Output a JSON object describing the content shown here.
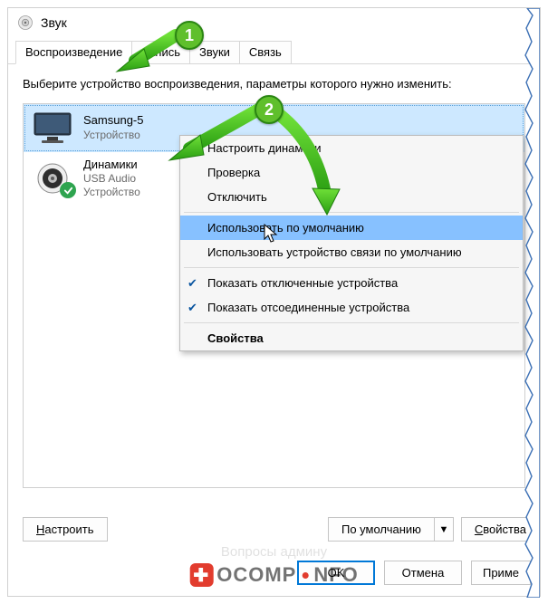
{
  "window": {
    "title": "Звук"
  },
  "tabs": {
    "playback": "Воспроизведение",
    "record": "Запись",
    "sounds": "Звуки",
    "comm": "Связь"
  },
  "instruction": "Выберите устройство воспроизведения, параметры которого нужно изменить:",
  "devices": {
    "samsung": {
      "name": "Samsung-5",
      "line2": "Устройство"
    },
    "speakers": {
      "name": "Динамики",
      "line2": "USB Audio",
      "line3": "Устройство"
    }
  },
  "menu": {
    "configure_speakers": "Настроить динамики",
    "test": "Проверка",
    "disable": "Отключить",
    "set_default": "Использовать по умолчанию",
    "set_default_comm": "Использовать устройство связи по умолчанию",
    "show_disabled": "Показать отключенные устройства",
    "show_disconnected": "Показать отсоединенные устройства",
    "properties": "Свойства"
  },
  "buttons": {
    "configure": "астроить",
    "configure_ul": "Н",
    "set_default": "По умолчанию",
    "properties": "войства",
    "properties_ul": "С",
    "ok": "OK",
    "cancel": "Отмена",
    "apply": "Приме"
  },
  "annotations": {
    "num1": "1",
    "num2": "2"
  },
  "watermark": {
    "brand_pre": "OCOMP",
    "brand_post": "NFO",
    "faint": "Вопросы админу"
  },
  "colors": {
    "accent": "#0078d7",
    "arrow_green": "#3fb321",
    "highlight": "#87c1ff"
  }
}
